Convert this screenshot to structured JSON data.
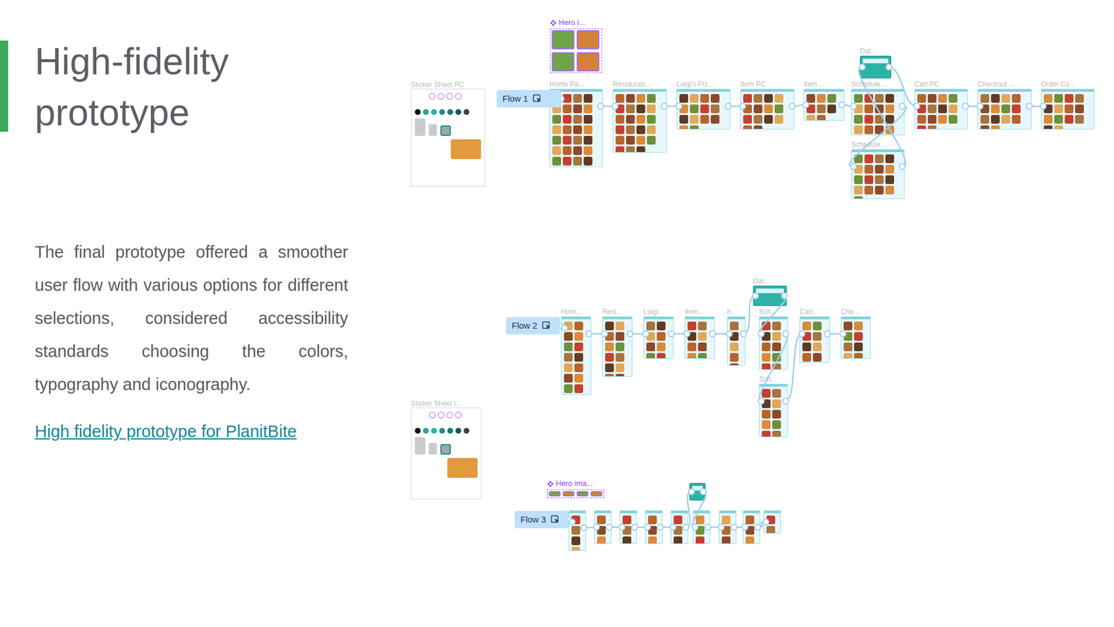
{
  "slide": {
    "title": "High-fidelity prototype",
    "body": "The final prototype offered a smoother user flow with various options for different selections, considered accessibility standards choosing the colors, typography and iconography.",
    "link": "High fidelity prototype for PlanitBite"
  },
  "canvas": {
    "sticker_sheets": [
      {
        "label": "Sticker Sheet PC"
      },
      {
        "label": "Sticker Sheet i..."
      }
    ],
    "components": [
      {
        "label": "Hero i..."
      },
      {
        "label": "Hero ima..."
      }
    ],
    "flows": [
      {
        "label": "Flow 1",
        "frames": [
          {
            "label": "Home Pa...",
            "kind": "page"
          },
          {
            "label": "Restauran...",
            "kind": "page"
          },
          {
            "label": "Luigi's Piz...",
            "kind": "page"
          },
          {
            "label": "Item PC",
            "kind": "page"
          },
          {
            "label": "Item ...",
            "kind": "page"
          },
          {
            "label": "Dat...",
            "kind": "popup"
          },
          {
            "label": "Schedule...",
            "kind": "page"
          },
          {
            "label": "Schedule...",
            "kind": "page"
          },
          {
            "label": "Cart PC",
            "kind": "page"
          },
          {
            "label": "Checkout ...",
            "kind": "page"
          },
          {
            "label": "Order Co...",
            "kind": "page"
          }
        ]
      },
      {
        "label": "Flow 2",
        "frames": [
          {
            "label": "Dat...",
            "kind": "popup"
          },
          {
            "label": "Hom...",
            "kind": "page"
          },
          {
            "label": "Rest...",
            "kind": "page"
          },
          {
            "label": "Luigi...",
            "kind": "page"
          },
          {
            "label": "Item...",
            "kind": "page"
          },
          {
            "label": "It...",
            "kind": "page"
          },
          {
            "label": "Sch...",
            "kind": "page"
          },
          {
            "label": "Sch...",
            "kind": "page"
          },
          {
            "label": "Cart...",
            "kind": "page"
          },
          {
            "label": "Che...",
            "kind": "page"
          }
        ]
      },
      {
        "label": "Flow 3",
        "frames": [
          {
            "kind": "page"
          },
          {
            "kind": "page"
          },
          {
            "kind": "page"
          },
          {
            "kind": "page"
          },
          {
            "kind": "page"
          },
          {
            "kind": "popup"
          },
          {
            "kind": "page"
          },
          {
            "kind": "page"
          },
          {
            "kind": "page"
          },
          {
            "kind": "page"
          }
        ]
      }
    ]
  }
}
